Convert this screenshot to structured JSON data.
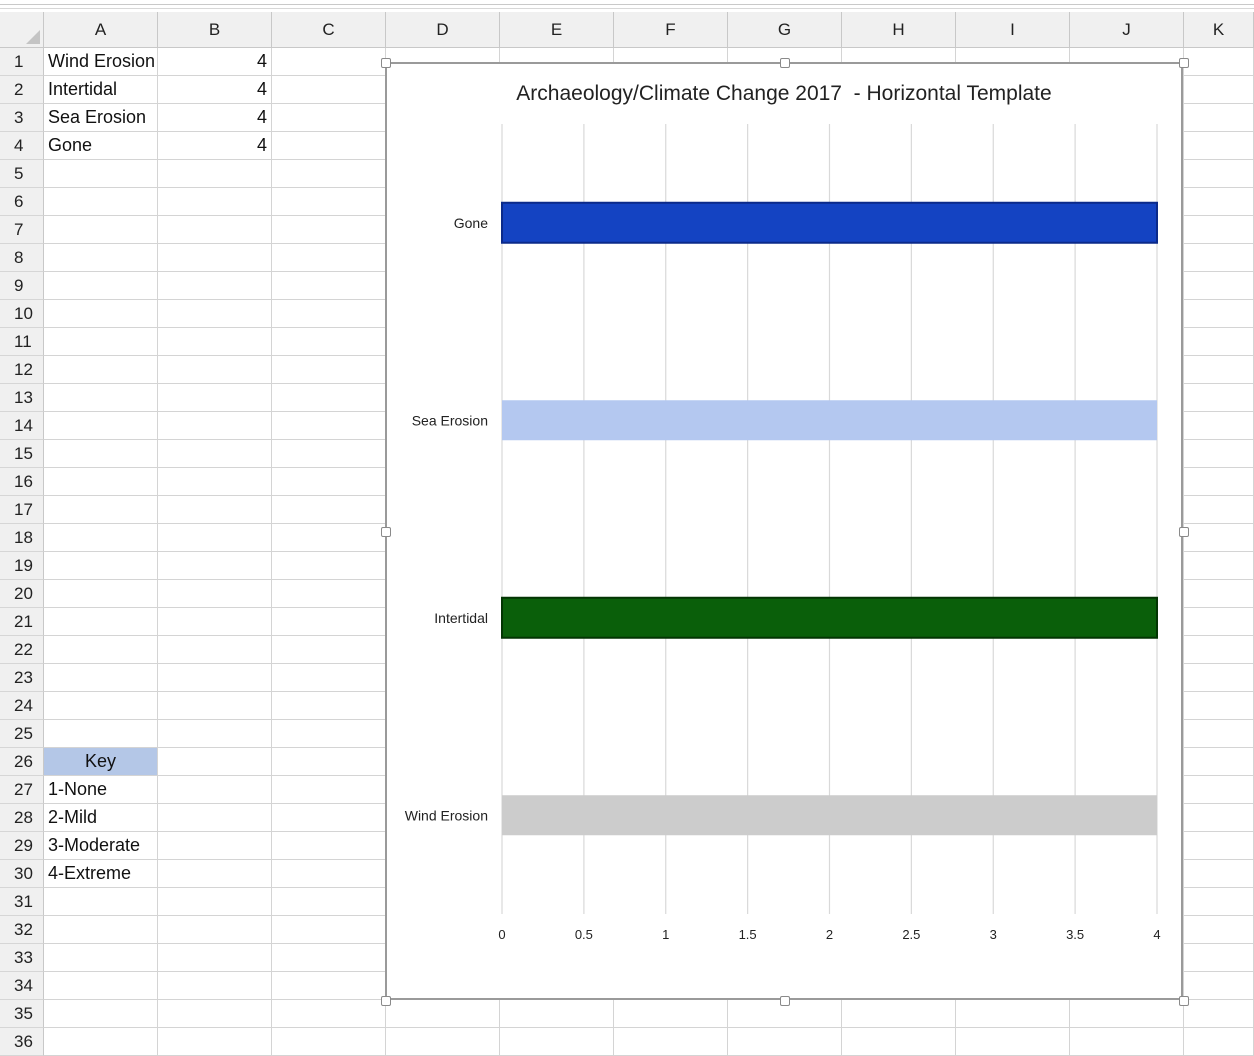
{
  "columns": [
    "A",
    "B",
    "C",
    "D",
    "E",
    "F",
    "G",
    "H",
    "I",
    "J",
    "K"
  ],
  "rows": [
    "1",
    "2",
    "3",
    "4",
    "5",
    "6",
    "7",
    "8",
    "9",
    "10",
    "11",
    "12",
    "13",
    "14",
    "15",
    "16",
    "17",
    "18",
    "19",
    "20",
    "21",
    "22",
    "23",
    "24",
    "25",
    "26",
    "27",
    "28",
    "29",
    "30",
    "31",
    "32",
    "33",
    "34",
    "35",
    "36"
  ],
  "data_rows": [
    {
      "label": "Wind Erosion",
      "value": "4"
    },
    {
      "label": "Intertidal",
      "value": "4"
    },
    {
      "label": "Sea Erosion",
      "value": "4"
    },
    {
      "label": "Gone",
      "value": "4"
    }
  ],
  "key": {
    "header": "Key",
    "items": [
      "1-None",
      "2-Mild",
      "3-Moderate",
      "4-Extreme"
    ]
  },
  "colors": {
    "key_fill": "#b4c7e7",
    "gone": "#1443c2",
    "sea_erosion": "#b4c8f0",
    "intertidal": "#0a5f0a",
    "wind_erosion": "#cccccc"
  },
  "chart_data": {
    "type": "bar",
    "orientation": "horizontal",
    "title": "Archaeology/Climate Change 2017  - Horizontal Template",
    "categories": [
      "Gone",
      "Sea Erosion",
      "Intertidal",
      "Wind Erosion"
    ],
    "values": [
      4,
      4,
      4,
      4
    ],
    "bar_colors": [
      "#1443c2",
      "#b4c8f0",
      "#0a5f0a",
      "#cccccc"
    ],
    "xlim": [
      0,
      4
    ],
    "xticks": [
      "0",
      "0.5",
      "1",
      "1.5",
      "2",
      "2.5",
      "3",
      "3.5",
      "4"
    ],
    "grid": true,
    "legend": "none"
  }
}
